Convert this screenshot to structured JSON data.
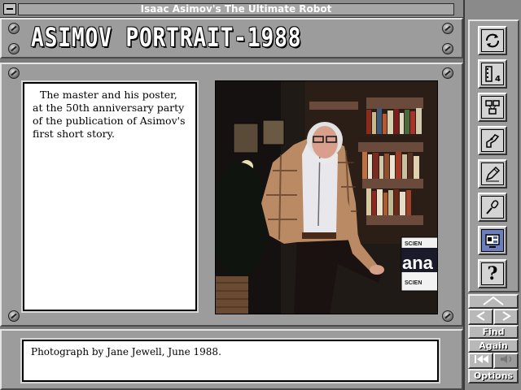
{
  "window": {
    "title": "Isaac Asimov's The Ultimate Robot",
    "dropdown_glyph": "▼"
  },
  "header": {
    "title": "ASIMOV PORTRAIT-1988"
  },
  "caption": {
    "text": "The master and his poster, at the 50th anniversary party of the publication of Asimov's first short story."
  },
  "photo": {
    "poster_text_top": "SCIEN",
    "poster_text_big": "ana",
    "poster_text_bottom": "SCIEN"
  },
  "credit": {
    "text": "Photograph by Jane Jewell, June 1988."
  },
  "toolbar": {
    "tools": [
      {
        "name": "cycle-icon"
      },
      {
        "name": "film-strip-icon",
        "label": "4"
      },
      {
        "name": "diagram-icon"
      },
      {
        "name": "robot-arm-icon"
      },
      {
        "name": "pen-writing-icon"
      },
      {
        "name": "microphone-icon"
      },
      {
        "name": "monitor-icon"
      },
      {
        "name": "help-icon",
        "label": "?"
      }
    ],
    "find_label": "Find",
    "again_label": "Again",
    "options_label": "Options"
  }
}
